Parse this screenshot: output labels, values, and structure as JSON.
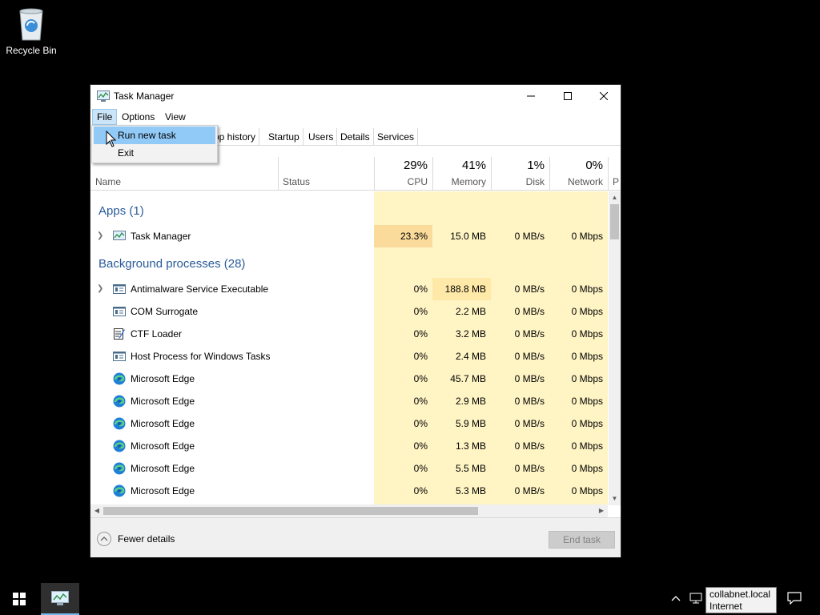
{
  "desktop": {
    "recycle_bin_label": "Recycle Bin"
  },
  "window": {
    "title": "Task Manager",
    "menu": [
      "File",
      "Options",
      "View"
    ],
    "tabs": [
      "pp history",
      "Startup",
      "Users",
      "Details",
      "Services"
    ],
    "columns": {
      "name": "Name",
      "status": "Status",
      "cpu": {
        "pct": "29%",
        "label": "CPU"
      },
      "memory": {
        "pct": "41%",
        "label": "Memory"
      },
      "disk": {
        "pct": "1%",
        "label": "Disk"
      },
      "network": {
        "pct": "0%",
        "label": "Network"
      },
      "power_partial": "P"
    },
    "groups": {
      "apps": "Apps (1)",
      "background": "Background processes (28)"
    },
    "apps": [
      {
        "name": "Task Manager",
        "cpu": "23.3%",
        "memory": "15.0 MB",
        "disk": "0 MB/s",
        "network": "0 Mbps",
        "icon": "taskmanager-icon"
      }
    ],
    "background": [
      {
        "name": "Antimalware Service Executable",
        "cpu": "0%",
        "memory": "188.8 MB",
        "disk": "0 MB/s",
        "network": "0 Mbps",
        "icon": "service-icon"
      },
      {
        "name": "COM Surrogate",
        "cpu": "0%",
        "memory": "2.2 MB",
        "disk": "0 MB/s",
        "network": "0 Mbps",
        "icon": "service-icon"
      },
      {
        "name": "CTF Loader",
        "cpu": "0%",
        "memory": "3.2 MB",
        "disk": "0 MB/s",
        "network": "0 Mbps",
        "icon": "notepad-pen-icon"
      },
      {
        "name": "Host Process for Windows Tasks",
        "cpu": "0%",
        "memory": "2.4 MB",
        "disk": "0 MB/s",
        "network": "0 Mbps",
        "icon": "service-icon"
      },
      {
        "name": "Microsoft Edge",
        "cpu": "0%",
        "memory": "45.7 MB",
        "disk": "0 MB/s",
        "network": "0 Mbps",
        "icon": "edge-icon"
      },
      {
        "name": "Microsoft Edge",
        "cpu": "0%",
        "memory": "2.9 MB",
        "disk": "0 MB/s",
        "network": "0 Mbps",
        "icon": "edge-icon"
      },
      {
        "name": "Microsoft Edge",
        "cpu": "0%",
        "memory": "5.9 MB",
        "disk": "0 MB/s",
        "network": "0 Mbps",
        "icon": "edge-icon"
      },
      {
        "name": "Microsoft Edge",
        "cpu": "0%",
        "memory": "1.3 MB",
        "disk": "0 MB/s",
        "network": "0 Mbps",
        "icon": "edge-icon"
      },
      {
        "name": "Microsoft Edge",
        "cpu": "0%",
        "memory": "5.5 MB",
        "disk": "0 MB/s",
        "network": "0 Mbps",
        "icon": "edge-icon"
      },
      {
        "name": "Microsoft Edge",
        "cpu": "0%",
        "memory": "5.3 MB",
        "disk": "0 MB/s",
        "network": "0 Mbps",
        "icon": "edge-icon"
      }
    ],
    "footer": {
      "fewer_details": "Fewer details",
      "end_task": "End task"
    }
  },
  "file_menu": {
    "items": [
      "Run new task",
      "Exit"
    ],
    "highlighted": "Run new task"
  },
  "taskbar": {
    "tooltip_line1": "collabnet.local",
    "tooltip_line2": "Internet access"
  },
  "colors": {
    "accent": "#2a5b9a",
    "cpu_hot": "#fadb9b",
    "mem_warm": "#ffe9a8",
    "tint": "#fff4c4",
    "menu_highlight": "#91c9f7"
  }
}
